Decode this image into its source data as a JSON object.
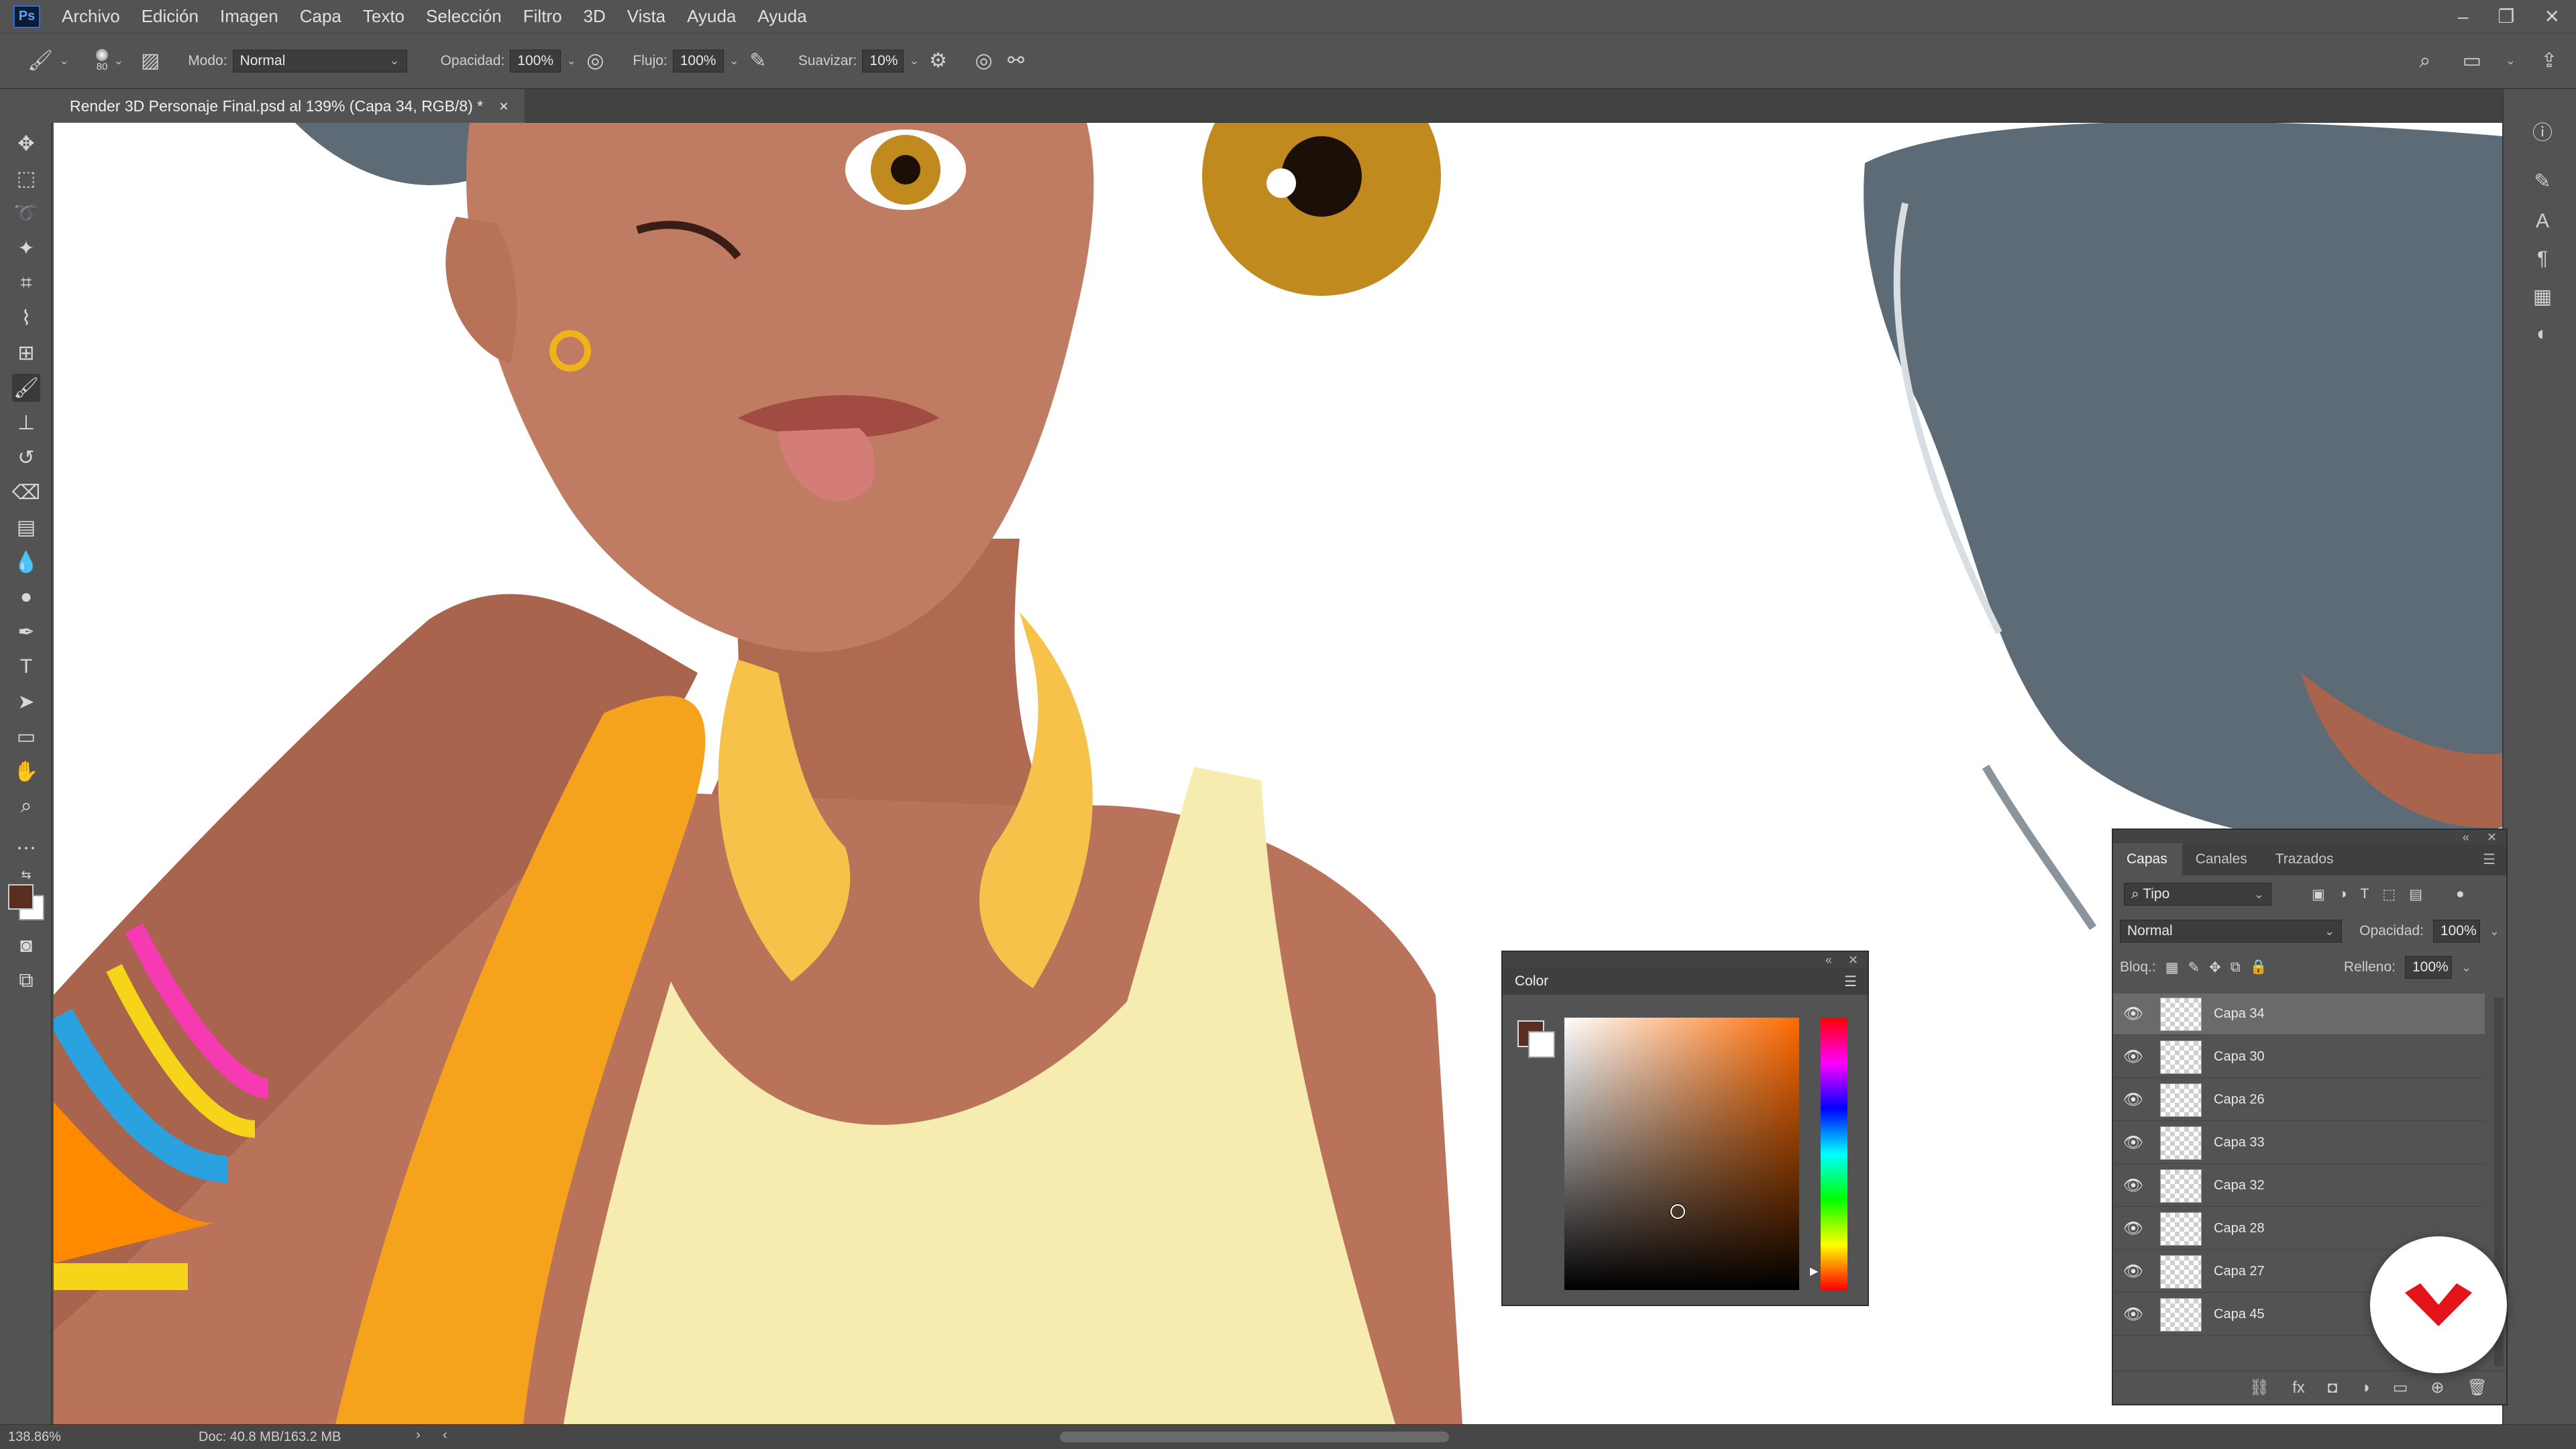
{
  "app": {
    "logo": "Ps",
    "menu": [
      "Archivo",
      "Edición",
      "Imagen",
      "Capa",
      "Texto",
      "Selección",
      "Filtro",
      "3D",
      "Vista",
      "Ayuda"
    ],
    "window_controls": {
      "minimize": "–",
      "restore": "❐",
      "close": "✕"
    }
  },
  "options": {
    "brush_size": "80",
    "mode_label": "Modo:",
    "mode_value": "Normal",
    "opacity_label": "Opacidad:",
    "opacity_value": "100%",
    "flow_label": "Flujo:",
    "flow_value": "100%",
    "smooth_label": "Suavizar:",
    "smooth_value": "10%"
  },
  "document": {
    "tab_title": "Render 3D Personaje Final.psd al 139% (Capa 34, RGB/8) *",
    "close": "×"
  },
  "color_panel": {
    "title": "Color",
    "foreground": "#5b2e22",
    "background": "#ffffff",
    "hue_color": "#ff6a00"
  },
  "layers_panel": {
    "tabs": [
      "Capas",
      "Canales",
      "Trazados"
    ],
    "filter_label": "Tipo",
    "blend_mode": "Normal",
    "opacity_label": "Opacidad:",
    "opacity_value": "100%",
    "lock_label": "Bloq.:",
    "fill_label": "Relleno:",
    "fill_value": "100%",
    "layers": [
      {
        "name": "Capa 34",
        "selected": true
      },
      {
        "name": "Capa 30",
        "selected": false
      },
      {
        "name": "Capa 26",
        "selected": false
      },
      {
        "name": "Capa 33",
        "selected": false
      },
      {
        "name": "Capa 32",
        "selected": false
      },
      {
        "name": "Capa 28",
        "selected": false
      },
      {
        "name": "Capa 27",
        "selected": false
      },
      {
        "name": "Capa 45",
        "selected": false
      }
    ]
  },
  "status": {
    "zoom": "138.86%",
    "doc": "Doc: 40.8 MB/163.2 MB"
  },
  "colors": {
    "skin": "#b9735a",
    "hair": "#5d6b76",
    "iris": "#c08a1e",
    "top": "#f7ecb0",
    "strap": "#f5a21c",
    "headphones": "#f6c24a",
    "brand": "#e3151a"
  }
}
